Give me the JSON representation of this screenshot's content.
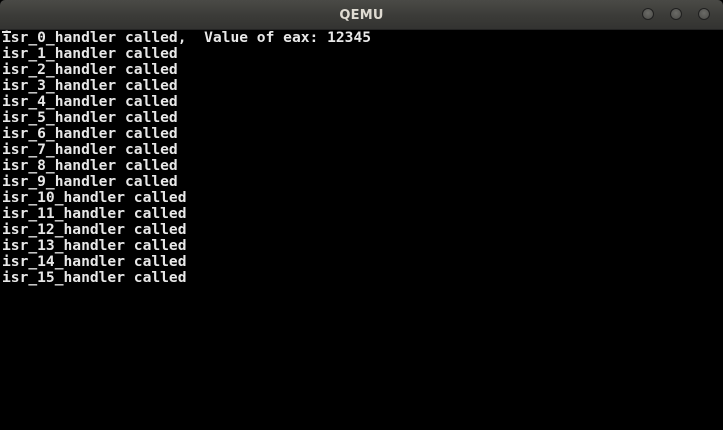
{
  "window": {
    "title": "QEMU",
    "controls": [
      "minimize-icon",
      "maximize-icon",
      "close-icon"
    ]
  },
  "console": {
    "lines": [
      "isr_0_handler called,  Value of eax: 12345",
      "isr_1_handler called",
      "isr_2_handler called",
      "isr_3_handler called",
      "isr_4_handler called",
      "isr_5_handler called",
      "isr_6_handler called",
      "isr_7_handler called",
      "isr_8_handler called",
      "isr_9_handler called",
      "isr_10_handler called",
      "isr_11_handler called",
      "isr_12_handler called",
      "isr_13_handler called",
      "isr_14_handler called",
      "isr_15_handler called"
    ]
  },
  "colors": {
    "terminal_background": "#000000",
    "terminal_text": "#e8e8e8",
    "titlebar": "#3c3c39",
    "title_text": "#dfdbd2"
  }
}
